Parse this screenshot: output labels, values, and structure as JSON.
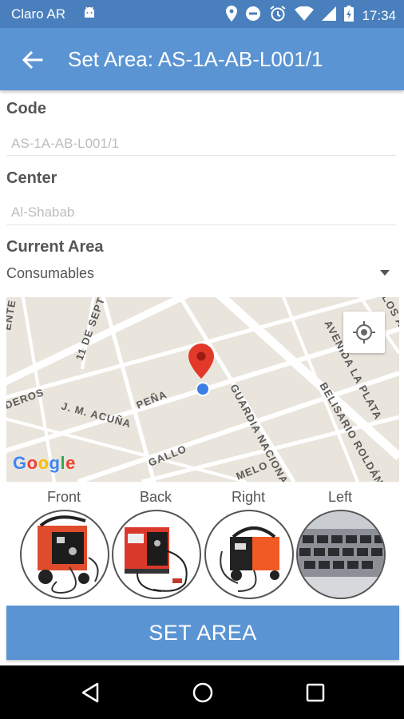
{
  "status_bar": {
    "carrier": "Claro AR",
    "time": "17:34"
  },
  "app_bar": {
    "title": "Set Area: AS-1A-AB-L001/1"
  },
  "fields": {
    "code": {
      "label": "Code",
      "value": "AS-1A-AB-L001/1"
    },
    "center": {
      "label": "Center",
      "value": "Al-Shabab"
    },
    "current_area": {
      "label": "Current Area",
      "value": "Consumables"
    }
  },
  "map": {
    "streets": [
      "11 DE SEPT",
      "AVENIDA LA PLATA",
      "DEROS",
      "PEÑA",
      "GUARDIA NACIONAL",
      "BELISARIO ROLDÁN",
      "J. M. ACUÑA",
      "GALLO",
      "MELO",
      "LOS AIRES",
      "ENTE"
    ],
    "logo": "Google"
  },
  "photos": [
    {
      "label": "Front"
    },
    {
      "label": "Back"
    },
    {
      "label": "Right"
    },
    {
      "label": "Left"
    }
  ],
  "action_button": "SET AREA",
  "colors": {
    "status_bar": "#4a7fbd",
    "app_bar": "#5b94d3",
    "button": "#5b94d3"
  }
}
